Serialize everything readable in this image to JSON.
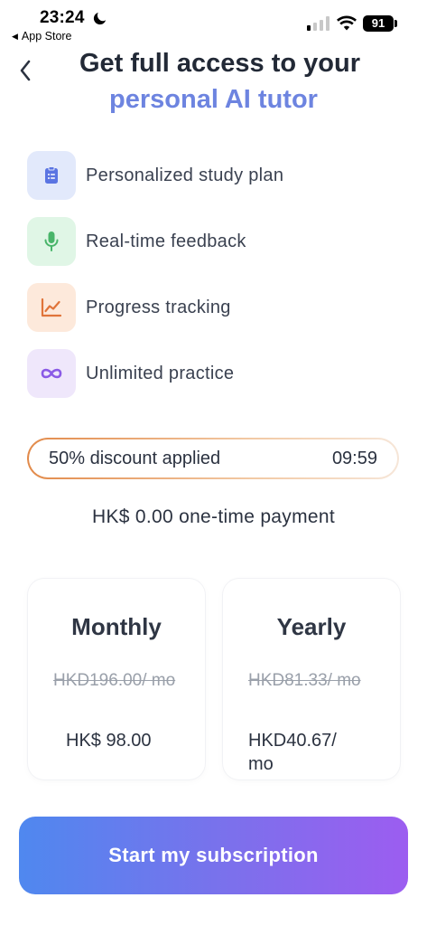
{
  "status_bar": {
    "time": "23:24",
    "back_app": "App Store",
    "battery": "91"
  },
  "header": {
    "title_line1": "Get full access to your",
    "title_line2": "personal AI tutor",
    "accent_color": "#6d84e0"
  },
  "features": [
    {
      "label": "Personalized study plan",
      "icon": "clipboard-list-icon",
      "bg": "#e2e9fb",
      "color": "#5a74e2"
    },
    {
      "label": "Real-time feedback",
      "icon": "microphone-icon",
      "bg": "#e0f6e6",
      "color": "#49b56a"
    },
    {
      "label": "Progress tracking",
      "icon": "chart-line-icon",
      "bg": "#fde9db",
      "color": "#e0743a"
    },
    {
      "label": "Unlimited practice",
      "icon": "infinity-icon",
      "bg": "#efe7fb",
      "color": "#8a5ae6"
    }
  ],
  "discount": {
    "label": "50% discount applied",
    "timer": "09:59"
  },
  "payment_text": "HK$ 0.00 one-time payment",
  "plans": [
    {
      "title": "Monthly",
      "old_price": "HKD196.00/ mo",
      "new_price": "HK$ 98.00"
    },
    {
      "title": "Yearly",
      "old_price": "HKD81.33/ mo",
      "new_price": "HKD40.67/ mo"
    }
  ],
  "cta": {
    "label": "Start my subscription"
  }
}
